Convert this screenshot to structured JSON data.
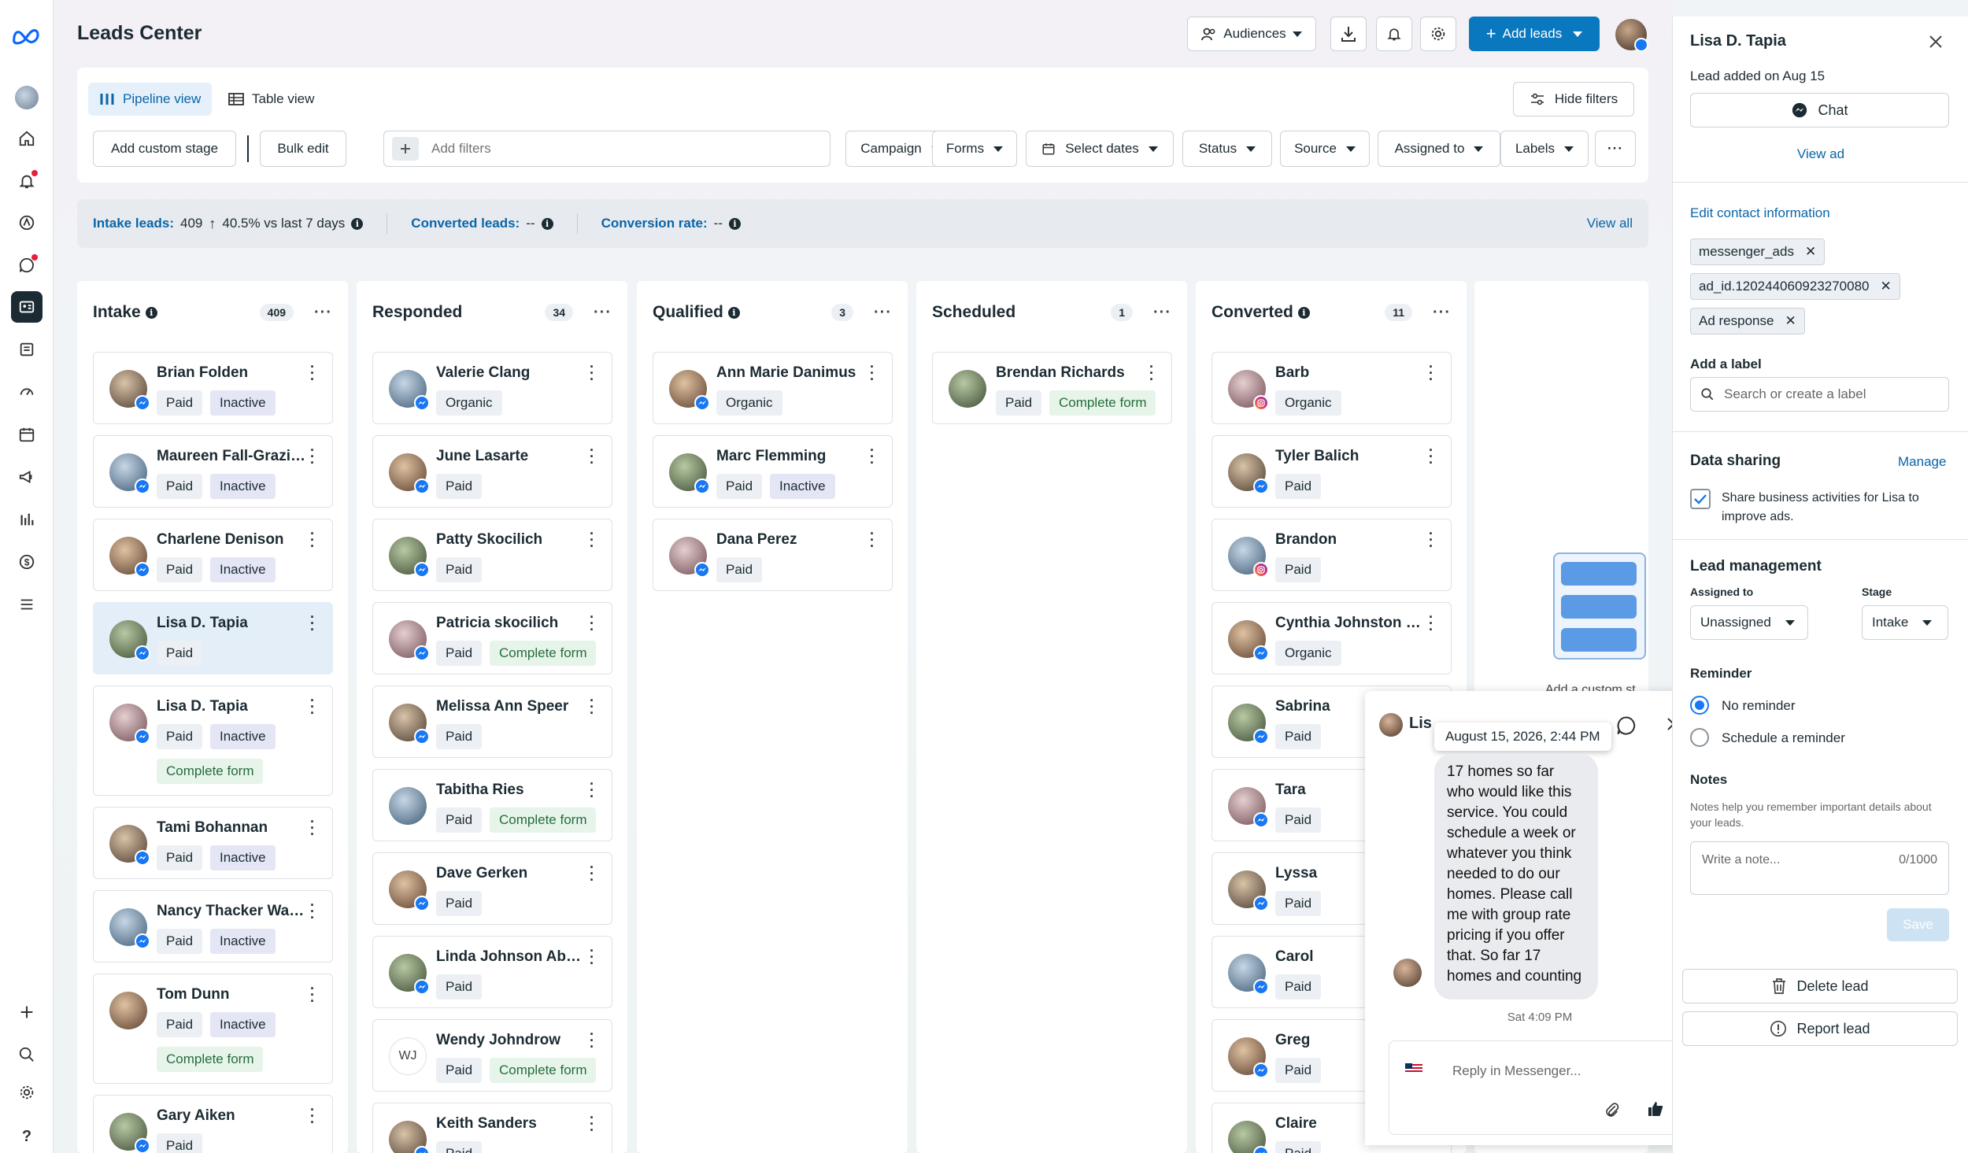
{
  "header": {
    "title": "Leads Center",
    "audiences_label": "Audiences",
    "add_leads_label": "Add leads"
  },
  "views": {
    "pipeline": "Pipeline view",
    "table": "Table view",
    "hide_filters": "Hide filters"
  },
  "toolbar": {
    "add_custom_stage": "Add custom stage",
    "bulk_edit": "Bulk edit",
    "add_filters_placeholder": "Add filters",
    "filters": [
      "Campaign",
      "Forms",
      "Select dates",
      "Status",
      "Source",
      "Assigned to",
      "Labels"
    ]
  },
  "stats": {
    "intake_label": "Intake leads:",
    "intake_value": "409",
    "intake_change": "40.5% vs last 7 days",
    "converted_label": "Converted leads:",
    "converted_value": "--",
    "rate_label": "Conversion rate:",
    "rate_value": "--",
    "view_all": "View all"
  },
  "columns": [
    {
      "title": "Intake",
      "count": "409",
      "info": true,
      "cards": [
        {
          "name": "Brian Folden",
          "source": "msg",
          "tags": [
            "Paid",
            "Inactive"
          ]
        },
        {
          "name": "Maureen Fall-Graziano",
          "source": "msg",
          "tags": [
            "Paid",
            "Inactive"
          ]
        },
        {
          "name": "Charlene Denison",
          "source": "msg",
          "tags": [
            "Paid",
            "Inactive"
          ]
        },
        {
          "name": "Lisa D. Tapia",
          "source": "msg",
          "tags": [
            "Paid"
          ],
          "selected": true
        },
        {
          "name": "Lisa D. Tapia",
          "source": "msg",
          "tags": [
            "Paid",
            "Inactive"
          ],
          "extra": "Complete form"
        },
        {
          "name": "Tami Bohannan",
          "source": "msg",
          "tags": [
            "Paid",
            "Inactive"
          ]
        },
        {
          "name": "Nancy Thacker Walton",
          "source": "msg",
          "tags": [
            "Paid",
            "Inactive"
          ]
        },
        {
          "name": "Tom Dunn",
          "source": "none",
          "tags": [
            "Paid",
            "Inactive"
          ],
          "extra": "Complete form"
        },
        {
          "name": "Gary Aiken",
          "source": "msg",
          "tags": [
            "Paid"
          ]
        }
      ]
    },
    {
      "title": "Responded",
      "count": "34",
      "info": false,
      "cards": [
        {
          "name": "Valerie Clang",
          "source": "msg",
          "tags": [
            "Organic"
          ]
        },
        {
          "name": "June Lasarte",
          "source": "msg",
          "tags": [
            "Paid"
          ]
        },
        {
          "name": "Patty Skocilich",
          "source": "msg",
          "tags": [
            "Paid"
          ]
        },
        {
          "name": "Patricia skocilich",
          "source": "msg",
          "tags": [
            "Paid",
            "Complete form"
          ]
        },
        {
          "name": "Melissa Ann Speer",
          "source": "msg",
          "tags": [
            "Paid"
          ]
        },
        {
          "name": "Tabitha Ries",
          "source": "none",
          "tags": [
            "Paid",
            "Complete form"
          ]
        },
        {
          "name": "Dave Gerken",
          "source": "msg",
          "tags": [
            "Paid"
          ]
        },
        {
          "name": "Linda Johnson Abbott",
          "source": "msg",
          "tags": [
            "Paid"
          ]
        },
        {
          "name": "Wendy Johndrow",
          "source": "none",
          "initials": "WJ",
          "tags": [
            "Paid",
            "Complete form"
          ]
        },
        {
          "name": "Keith Sanders",
          "source": "msg",
          "tags": [
            "Paid"
          ]
        }
      ]
    },
    {
      "title": "Qualified",
      "count": "3",
      "info": true,
      "cards": [
        {
          "name": "Ann Marie Danimus",
          "source": "msg",
          "tags": [
            "Organic"
          ]
        },
        {
          "name": "Marc Flemming",
          "source": "msg",
          "tags": [
            "Paid",
            "Inactive"
          ]
        },
        {
          "name": "Dana Perez",
          "source": "msg",
          "tags": [
            "Paid"
          ]
        }
      ]
    },
    {
      "title": "Scheduled",
      "count": "1",
      "info": false,
      "cards": [
        {
          "name": "Brendan Richards",
          "source": "none",
          "tags": [
            "Paid",
            "Complete form"
          ]
        }
      ]
    },
    {
      "title": "Converted",
      "count": "11",
      "info": true,
      "cards": [
        {
          "name": "Barb",
          "source": "ig",
          "tags": [
            "Organic"
          ]
        },
        {
          "name": "Tyler Balich",
          "source": "msg",
          "tags": [
            "Paid"
          ]
        },
        {
          "name": "Brandon",
          "source": "ig",
          "tags": [
            "Paid"
          ]
        },
        {
          "name": "Cynthia Johnston Ferris",
          "source": "msg",
          "tags": [
            "Organic"
          ]
        },
        {
          "name": "Sabrina",
          "source": "msg",
          "tags": [
            "Paid"
          ]
        },
        {
          "name": "Tara",
          "source": "msg",
          "tags": [
            "Paid"
          ]
        },
        {
          "name": "Lyssa",
          "source": "msg",
          "tags": [
            "Paid"
          ]
        },
        {
          "name": "Carol",
          "source": "msg",
          "tags": [
            "Paid"
          ]
        },
        {
          "name": "Greg",
          "source": "msg",
          "tags": [
            "Paid"
          ]
        },
        {
          "name": "Claire",
          "source": "msg",
          "tags": [
            "Paid"
          ]
        }
      ]
    }
  ],
  "add_stage_partial": "Add a custom st",
  "panel": {
    "name": "Lisa D. Tapia",
    "added": "Lead added on Aug 15",
    "chat_label": "Chat",
    "view_ad": "View ad",
    "edit_contact": "Edit contact information",
    "labels": [
      "messenger_ads",
      "ad_id.120244060923270080",
      "Ad response"
    ],
    "add_label_title": "Add a label",
    "label_placeholder": "Search or create a label",
    "data_sharing_title": "Data sharing",
    "manage": "Manage",
    "share_text": "Share business activities for Lisa to improve ads.",
    "lead_mgmt_title": "Lead management",
    "assigned_to_label": "Assigned to",
    "assigned_value": "Unassigned",
    "stage_label": "Stage",
    "stage_value": "Intake",
    "reminder_title": "Reminder",
    "no_reminder": "No reminder",
    "schedule_reminder": "Schedule a reminder",
    "notes_title": "Notes",
    "notes_help": "Notes help you remember important details about your leads.",
    "notes_placeholder": "Write a note...",
    "notes_count": "0/1000",
    "save": "Save",
    "delete_lead": "Delete lead",
    "report_lead": "Report lead"
  },
  "chat": {
    "name_partial": "Lis",
    "timestamp_tooltip": "August 15, 2026, 2:44 PM",
    "message": "17 homes so far who would like this service.  You could schedule a week or whatever you think needed to do our homes.  Please call me with group rate pricing if you offer that.  So far 17 homes and counting",
    "time_sep": "Sat 4:09 PM",
    "reply_placeholder": "Reply in Messenger..."
  },
  "colors": {
    "accent": "#0a78be",
    "messenger": "#1877f2",
    "selected_card": "#e3eef8"
  },
  "icons": [
    "meta-logo",
    "home-icon",
    "bell-icon",
    "ads-icon",
    "chat-icon",
    "leads-icon",
    "pages-icon",
    "gauge-icon",
    "calendar-icon",
    "megaphone-icon",
    "insights-icon",
    "dollar-icon",
    "menu-icon",
    "plus-icon",
    "search-icon",
    "gear-icon",
    "help-icon"
  ]
}
